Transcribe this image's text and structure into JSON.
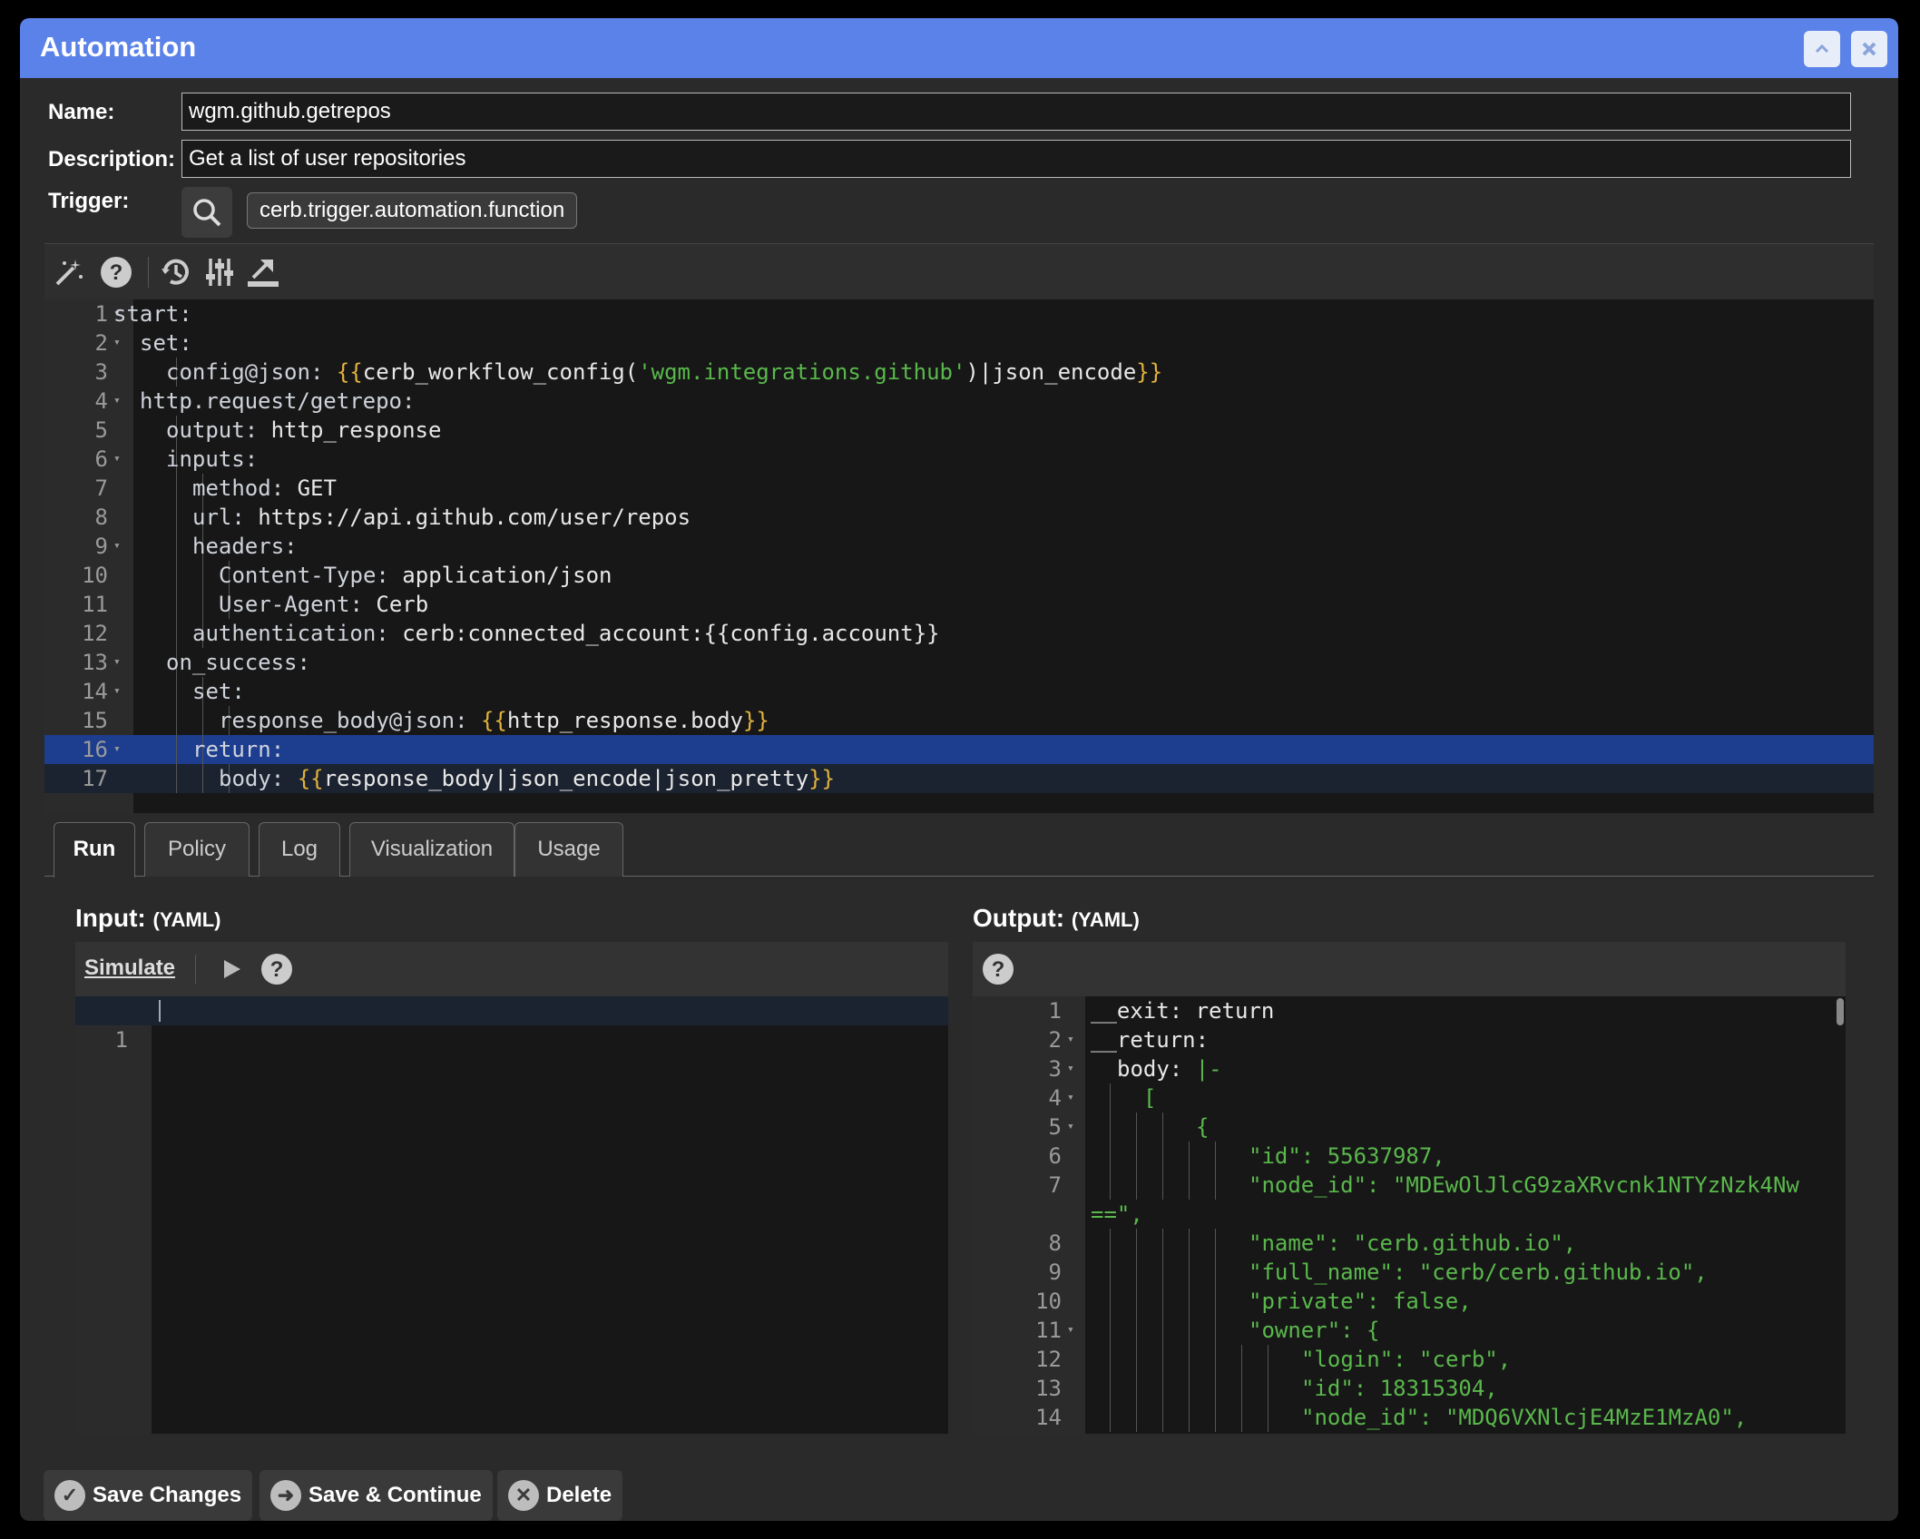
{
  "window": {
    "title": "Automation"
  },
  "form": {
    "name_label": "Name:",
    "name_value": "wgm.github.getrepos",
    "description_label": "Description:",
    "description_value": "Get a list of user repositories",
    "trigger_label": "Trigger:",
    "trigger_value": "cerb.trigger.automation.function"
  },
  "editor": {
    "lines": [
      {
        "n": "1",
        "fold": true,
        "indent": 0,
        "parts": [
          [
            "k",
            "start:"
          ]
        ]
      },
      {
        "n": "2",
        "fold": true,
        "indent": 1,
        "parts": [
          [
            "k",
            "set:"
          ]
        ]
      },
      {
        "n": "3",
        "fold": false,
        "indent": 2,
        "parts": [
          [
            "k",
            "config@json: "
          ],
          [
            "b",
            "{{"
          ],
          [
            "",
            "cerb_workflow_config("
          ],
          [
            "s",
            "'wgm.integrations.github'"
          ],
          [
            "",
            ")|json_encode"
          ],
          [
            "b",
            "}}"
          ]
        ]
      },
      {
        "n": "4",
        "fold": true,
        "indent": 1,
        "parts": [
          [
            "k",
            "http.request/getrepo:"
          ]
        ]
      },
      {
        "n": "5",
        "fold": false,
        "indent": 2,
        "parts": [
          [
            "k",
            "output: "
          ],
          [
            "",
            "http_response"
          ]
        ]
      },
      {
        "n": "6",
        "fold": true,
        "indent": 2,
        "parts": [
          [
            "k",
            "inputs:"
          ]
        ]
      },
      {
        "n": "7",
        "fold": false,
        "indent": 3,
        "parts": [
          [
            "k",
            "method: "
          ],
          [
            "",
            "GET"
          ]
        ]
      },
      {
        "n": "8",
        "fold": false,
        "indent": 3,
        "parts": [
          [
            "k",
            "url: "
          ],
          [
            "",
            "https://api.github.com/user/repos"
          ]
        ]
      },
      {
        "n": "9",
        "fold": true,
        "indent": 3,
        "parts": [
          [
            "k",
            "headers:"
          ]
        ]
      },
      {
        "n": "10",
        "fold": false,
        "indent": 4,
        "parts": [
          [
            "k",
            "Content-Type: "
          ],
          [
            "",
            "application/json"
          ]
        ]
      },
      {
        "n": "11",
        "fold": false,
        "indent": 4,
        "parts": [
          [
            "k",
            "User-Agent: "
          ],
          [
            "",
            "Cerb"
          ]
        ]
      },
      {
        "n": "12",
        "fold": false,
        "indent": 3,
        "parts": [
          [
            "k",
            "authentication: "
          ],
          [
            "",
            "cerb:connected_account:{{config.account}}"
          ]
        ]
      },
      {
        "n": "13",
        "fold": true,
        "indent": 2,
        "parts": [
          [
            "k",
            "on_success:"
          ]
        ]
      },
      {
        "n": "14",
        "fold": true,
        "indent": 3,
        "parts": [
          [
            "k",
            "set:"
          ]
        ]
      },
      {
        "n": "15",
        "fold": false,
        "indent": 4,
        "parts": [
          [
            "k",
            "response_body@json: "
          ],
          [
            "b",
            "{{"
          ],
          [
            "",
            "http_response.body"
          ],
          [
            "b",
            "}}"
          ]
        ]
      },
      {
        "n": "16",
        "fold": true,
        "indent": 3,
        "highlight": true,
        "parts": [
          [
            "k",
            "return:"
          ]
        ]
      },
      {
        "n": "17",
        "fold": false,
        "indent": 4,
        "current": true,
        "parts": [
          [
            "k",
            "body: "
          ],
          [
            "b",
            "{{"
          ],
          [
            "",
            "response_body|json_encode|json_pretty"
          ],
          [
            "b",
            "}}"
          ]
        ]
      }
    ]
  },
  "tabs": [
    "Run",
    "Policy",
    "Log",
    "Visualization",
    "Usage"
  ],
  "input_pane": {
    "title": "Input:",
    "format": "(YAML)",
    "simulate_label": "Simulate",
    "line_number": "1"
  },
  "output_pane": {
    "title": "Output:",
    "format": "(YAML)",
    "lines": [
      {
        "n": "1",
        "fold": false,
        "indent": 0,
        "parts": [
          [
            "k",
            "__exit: "
          ],
          [
            "",
            "return"
          ]
        ]
      },
      {
        "n": "2",
        "fold": true,
        "indent": 0,
        "parts": [
          [
            "k",
            "__return:"
          ]
        ]
      },
      {
        "n": "3",
        "fold": true,
        "indent": 1,
        "parts": [
          [
            "k",
            "body: "
          ],
          [
            "g",
            "|-"
          ]
        ]
      },
      {
        "n": "4",
        "fold": true,
        "indent": 2,
        "parts": [
          [
            "g",
            "["
          ]
        ]
      },
      {
        "n": "5",
        "fold": true,
        "indent": 4,
        "parts": [
          [
            "g",
            "{"
          ]
        ]
      },
      {
        "n": "6",
        "fold": false,
        "indent": 6,
        "parts": [
          [
            "g",
            "\"id\": 55637987,"
          ]
        ]
      },
      {
        "n": "7",
        "fold": false,
        "indent": 6,
        "parts": [
          [
            "g",
            "\"node_id\": \"MDEwOlJlcG9zaXRvcnk1NTYzNzk4Nw"
          ]
        ]
      },
      {
        "n": "",
        "fold": false,
        "indent": 0,
        "parts": [
          [
            "g",
            "==\","
          ]
        ]
      },
      {
        "n": "8",
        "fold": false,
        "indent": 6,
        "parts": [
          [
            "g",
            "\"name\": \"cerb.github.io\","
          ]
        ]
      },
      {
        "n": "9",
        "fold": false,
        "indent": 6,
        "parts": [
          [
            "g",
            "\"full_name\": \"cerb/cerb.github.io\","
          ]
        ]
      },
      {
        "n": "10",
        "fold": false,
        "indent": 6,
        "parts": [
          [
            "g",
            "\"private\": false,"
          ]
        ]
      },
      {
        "n": "11",
        "fold": true,
        "indent": 6,
        "parts": [
          [
            "g",
            "\"owner\": {"
          ]
        ]
      },
      {
        "n": "12",
        "fold": false,
        "indent": 8,
        "parts": [
          [
            "g",
            "\"login\": \"cerb\","
          ]
        ]
      },
      {
        "n": "13",
        "fold": false,
        "indent": 8,
        "parts": [
          [
            "g",
            "\"id\": 18315304,"
          ]
        ]
      },
      {
        "n": "14",
        "fold": false,
        "indent": 8,
        "parts": [
          [
            "g",
            "\"node_id\": \"MDQ6VXNlcjE4MzE1MzA0\","
          ]
        ]
      }
    ]
  },
  "footer": {
    "save_label": "Save Changes",
    "save_continue_label": "Save & Continue",
    "delete_label": "Delete"
  }
}
